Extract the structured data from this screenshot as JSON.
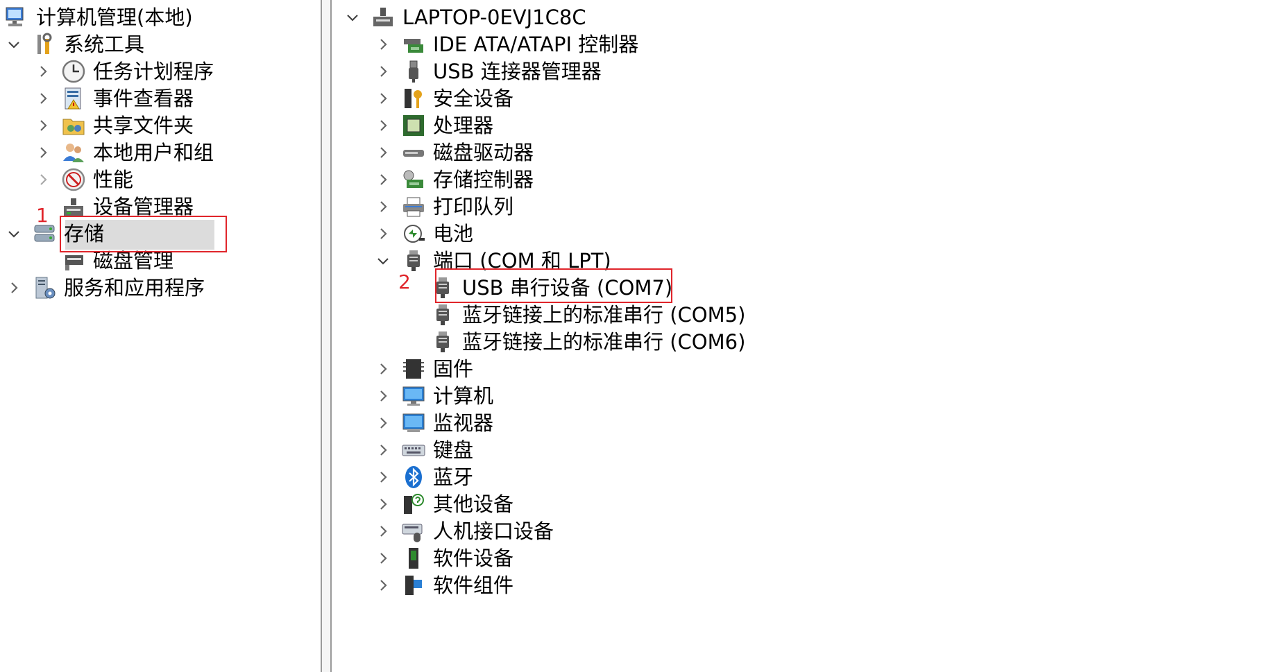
{
  "left_tree": {
    "root": "计算机管理(本地)",
    "system_tools": "系统工具",
    "task_scheduler": "任务计划程序",
    "event_viewer": "事件查看器",
    "shared_folders": "共享文件夹",
    "local_users": "本地用户和组",
    "performance": "性能",
    "device_manager": "设备管理器",
    "storage": "存储",
    "disk_management": "磁盘管理",
    "services_apps": "服务和应用程序"
  },
  "annotations": {
    "one": "1",
    "two": "2"
  },
  "device_tree": {
    "computer_name": "LAPTOP-0EVJ1C8C",
    "ide": "IDE ATA/ATAPI 控制器",
    "usb_ctrl": "USB 连接器管理器",
    "security": "安全设备",
    "processor": "处理器",
    "disk_drive": "磁盘驱动器",
    "storage_ctrl": "存储控制器",
    "print_queue": "打印队列",
    "battery": "电池",
    "ports": "端口 (COM 和 LPT)",
    "usb_serial": "USB 串行设备 (COM7)",
    "bt_com5": "蓝牙链接上的标准串行 (COM5)",
    "bt_com6": "蓝牙链接上的标准串行 (COM6)",
    "firmware": "固件",
    "computer": "计算机",
    "monitor": "监视器",
    "keyboard": "键盘",
    "bluetooth": "蓝牙",
    "other": "其他设备",
    "hid": "人机接口设备",
    "software_dev": "软件设备",
    "software_comp": "软件组件"
  },
  "colors": {
    "highlight": "#e0252b",
    "selection": "#dcdcdc"
  }
}
